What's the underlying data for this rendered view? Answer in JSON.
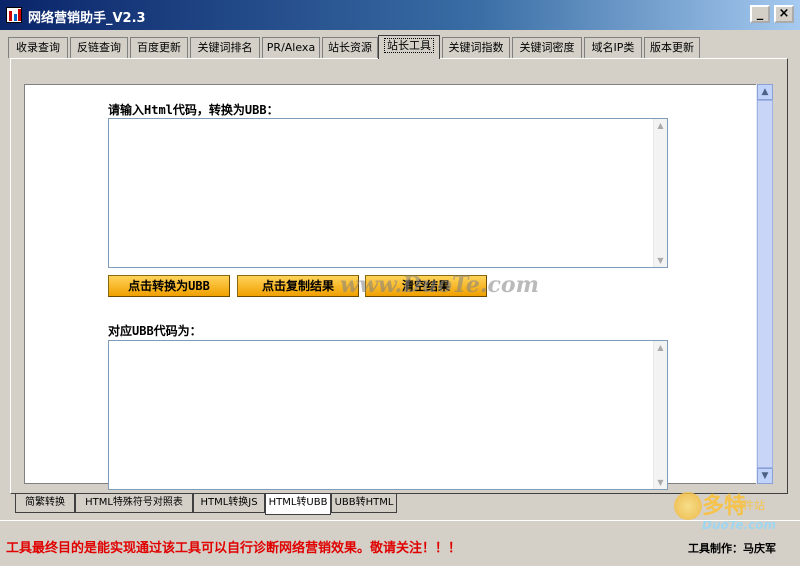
{
  "window": {
    "title": "网络营销助手_V2.3",
    "minimize_label": "_",
    "close_label": "×"
  },
  "tabs_top": [
    {
      "label": "收录查询"
    },
    {
      "label": "反链查询"
    },
    {
      "label": "百度更新"
    },
    {
      "label": "关键词排名"
    },
    {
      "label": "PR/Alexa"
    },
    {
      "label": "站长资源"
    },
    {
      "label": "站长工具",
      "active": true
    },
    {
      "label": "关键词指数"
    },
    {
      "label": "关键词密度"
    },
    {
      "label": "域名IP类"
    },
    {
      "label": "版本更新"
    }
  ],
  "main": {
    "input_label": "请输入Html代码，转换为UBB：",
    "input_value": "",
    "output_label": "对应UBB代码为：",
    "output_value": "",
    "buttons": {
      "convert": "点击转换为UBB",
      "copy": "点击复制结果",
      "clear": "清空结果"
    },
    "watermark": "www.DuoTe.com"
  },
  "tabs_bottom": [
    {
      "label": "简繁转换"
    },
    {
      "label": "HTML特殊符号对照表"
    },
    {
      "label": "HTML转换JS"
    },
    {
      "label": "HTML转UBB",
      "active": true
    },
    {
      "label": "UBB转HTML"
    }
  ],
  "status": {
    "message": "工具最终目的是能实现通过该工具可以自行诊断网络营销效果。敬请关注！！！",
    "author": "工具制作：马庆军"
  },
  "logo": {
    "text": "多特",
    "sub": "软件站",
    "url": "DuoTe.com"
  },
  "colors": {
    "status_red": "#e00000",
    "button_orange": "#f0a000",
    "titlebar_blue": "#0a246a"
  }
}
